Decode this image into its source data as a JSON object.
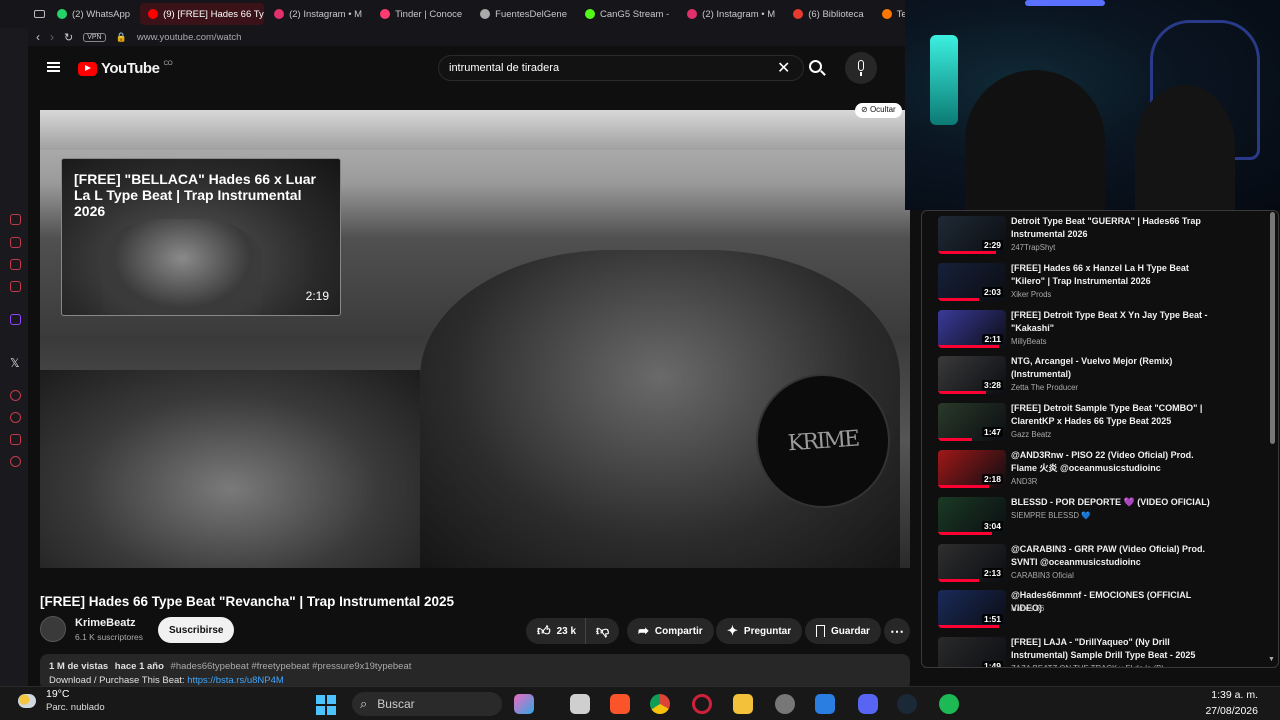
{
  "browser": {
    "tabs": [
      {
        "label": "(2) WhatsApp",
        "active": false
      },
      {
        "label": "(9) [FREE] Hades 66 Type",
        "active": true
      },
      {
        "label": "(2) Instagram • M",
        "active": false
      },
      {
        "label": "Tinder | Conoce",
        "active": false
      },
      {
        "label": "FuentesDelGene",
        "active": false
      },
      {
        "label": "CanG5 Stream -",
        "active": false
      },
      {
        "label": "(2) Instagram • M",
        "active": false
      },
      {
        "label": "(6) Biblioteca",
        "active": false
      },
      {
        "label": "Temu Colombia",
        "active": false
      }
    ],
    "vpn_label": "VPN",
    "url": "www.youtube.com/watch"
  },
  "youtube": {
    "logo_text": "YouTube",
    "country_code": "CO",
    "search_value": "intrumental de tiradera"
  },
  "player": {
    "hide_label": "Ocultar",
    "endcard": {
      "title": "[FREE] \"BELLACA\" Hades 66 x Luar La L Type Beat | Trap Instrumental 2026",
      "duration": "2:19"
    },
    "watermark_text": "KRIME"
  },
  "video": {
    "title": "[FREE] Hades 66 Type Beat \"Revancha\" | Trap Instrumental 2025",
    "channel_name": "KrimeBeatz",
    "subscribers": "6.1 K suscriptores",
    "subscribe_label": "Suscribirse",
    "like_count": "23 k",
    "share_label": "Compartir",
    "ask_label": "Preguntar",
    "save_label": "Guardar",
    "views": "1 M de vistas",
    "age": "hace 1 año",
    "tags": "#hades66typebeat #freetypebeat #pressure9x19typebeat",
    "download_text": "Download / Purchase This Beat:",
    "download_link": "https://bsta.rs/u8NP4M"
  },
  "recommendations": [
    {
      "title": "Detroit Type Beat \"GUERRA\" | Hades66 Trap Instrumental 2026",
      "channel": "247TrapShyt",
      "duration": "2:29",
      "progress": 0.85,
      "thumb_color": "#1f2a35"
    },
    {
      "title": "[FREE] Hades 66 x Hanzel La H Type Beat \"Kilero\" | Trap Instrumental 2026",
      "channel": "Xiker Prods",
      "duration": "2:03",
      "progress": 0.6,
      "thumb_color": "#16203a"
    },
    {
      "title": "[FREE] Detroit Type Beat X Yn Jay Type Beat - \"Kakashi\"",
      "channel": "MillyBeats",
      "duration": "2:11",
      "progress": 0.9,
      "thumb_color": "#3a3a9a"
    },
    {
      "title": "NTG, Arcangel - Vuelvo Mejor (Remix) (Instrumental)",
      "channel": "Zetta The Producer",
      "duration": "3:28",
      "progress": 0.7,
      "thumb_color": "#3a3a3a"
    },
    {
      "title": "[FREE] Detroit Sample Type Beat \"COMBO\" | ClarentKP x Hades 66 Type Beat 2025",
      "channel": "Gazz Beatz",
      "duration": "1:47",
      "progress": 0.5,
      "thumb_color": "#2a3a2a"
    },
    {
      "title": "@AND3Rnw - PISO 22 (Video Oficial) Prod. Flame 火炎 @oceanmusicstudioinc",
      "channel": "AND3R",
      "duration": "2:18",
      "progress": 0.75,
      "thumb_color": "#a01818"
    },
    {
      "title": "BLESSD - POR DEPORTE 💜 (VIDEO OFICIAL)",
      "channel": "SIEMPRE BLESSD 💙",
      "duration": "3:04",
      "progress": 0.8,
      "thumb_color": "#1a3a24"
    },
    {
      "title": "@CARABIN3 - GRR PAW (Video Oficial) Prod. SVNTI @oceanmusicstudioinc",
      "channel": "CARABIN3 Oficial",
      "duration": "2:13",
      "progress": 0.6,
      "thumb_color": "#2f2f2f"
    },
    {
      "title": "@Hades66mmnf - EMOCIONES (OFFICIAL VIDEO)",
      "channel": "Hades 66",
      "duration": "1:51",
      "progress": 0.9,
      "thumb_color": "#1a2a5a"
    },
    {
      "title": "[FREE] LAJA - \"DrillYaqueo\" (Ny Drill Instrumental) Sample Drill Type Beat - 2025",
      "channel": "ZAZA BEATZ ON THE TRACK y El de la (B)",
      "duration": "1:49",
      "progress": 0.7,
      "thumb_color": "#2a2a2a"
    }
  ],
  "taskbar": {
    "temperature": "19°C",
    "weather": "Parc. nublado",
    "search_label": "Buscar",
    "time": "1:39 a. m.",
    "date": "27/08/2026"
  },
  "colors": {
    "youtube_red": "#ff0000",
    "progress_red": "#ff0033",
    "link_blue": "#3ea6ff",
    "opera_red": "#c43a4a"
  }
}
